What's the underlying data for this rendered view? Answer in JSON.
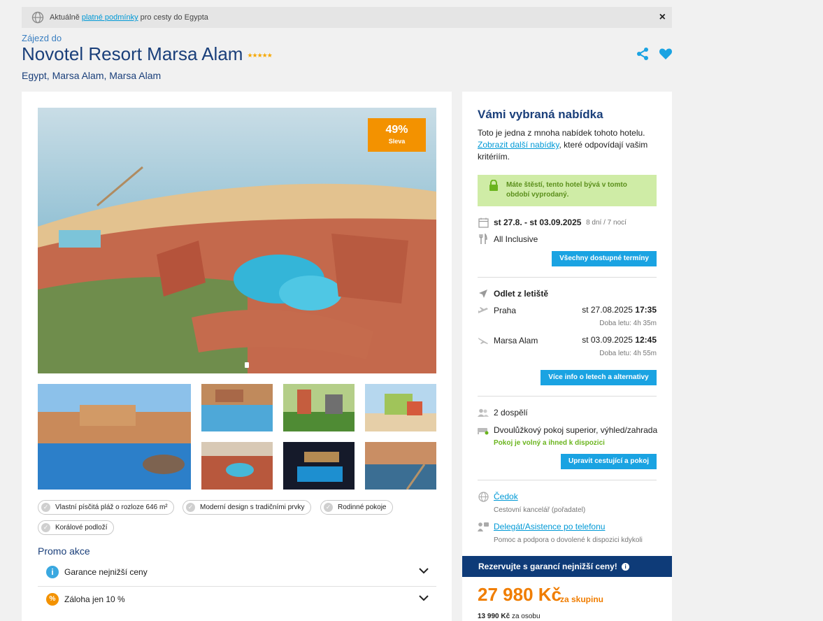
{
  "notice": {
    "prefix": "Aktuálně",
    "link": "platné podmínky",
    "suffix": "pro cesty do Egypta",
    "close": "×"
  },
  "hotel": {
    "subtitle": "Zájezd do",
    "name": "Novotel Resort Marsa Alam",
    "stars": "★★★★★",
    "location": "Egypt, Marsa Alam, Marsa Alam"
  },
  "gallery": {
    "discount_pct": "49%",
    "discount_label": "Sleva"
  },
  "tags": [
    "Vlastní písčitá pláž o rozloze 646 m²",
    "Moderní design s tradičními prvky",
    "Rodinné pokoje",
    "Korálové podloží"
  ],
  "promo": {
    "title": "Promo akce",
    "items": [
      {
        "label": "Garance nejnižší ceny",
        "icon": "info-icon",
        "color": "#3aa8e0"
      },
      {
        "label": "Záloha jen 10 %",
        "icon": "percent-icon",
        "color": "#f39200"
      }
    ]
  },
  "offer": {
    "title": "Vámi vybraná nabídka",
    "text1": "Toto je jedna z mnoha nabídek tohoto hotelu.",
    "link": "Zobrazit další nabídky",
    "text2": ", které odpovídají vašim kritériím.",
    "luck": "Máte štěstí, tento hotel bývá v tomto období vyprodaný.",
    "dates": "st 27.8. - st 03.09.2025",
    "nights": "8 dní / 7 nocí",
    "board": "All Inclusive",
    "all_dates_btn": "Všechny dostupné termíny",
    "departure_label": "Odlet z letiště",
    "out_city": "Praha",
    "out_date": "st 27.08.2025",
    "out_time": "17:35",
    "out_dur": "Doba letu: 4h 35m",
    "back_city": "Marsa Alam",
    "back_date": "st 03.09.2025",
    "back_time": "12:45",
    "back_dur": "Doba letu: 4h 55m",
    "flights_btn": "Více info o letech a alternativy",
    "travellers": "2 dospělí",
    "room": "Dvoulůžkový pokoj superior, výhled/zahrada",
    "room_avail": "Pokoj je volný a ihned k dispozici",
    "edit_btn": "Upravit cestující a pokoj",
    "agency": "Čedok",
    "agency_sub": "Cestovní kancelář (pořadatel)",
    "delegate": "Delegát/Asistence po telefonu",
    "delegate_sub": "Pomoc a podpora o dovolené k dispozici kdykoli",
    "banner": "Rezervujte s garancí nejnižší ceny!",
    "price": "27 980 Kč",
    "price_sub": "za skupinu",
    "per_person_price": "13 990 Kč",
    "per_person_label": "za osobu"
  }
}
